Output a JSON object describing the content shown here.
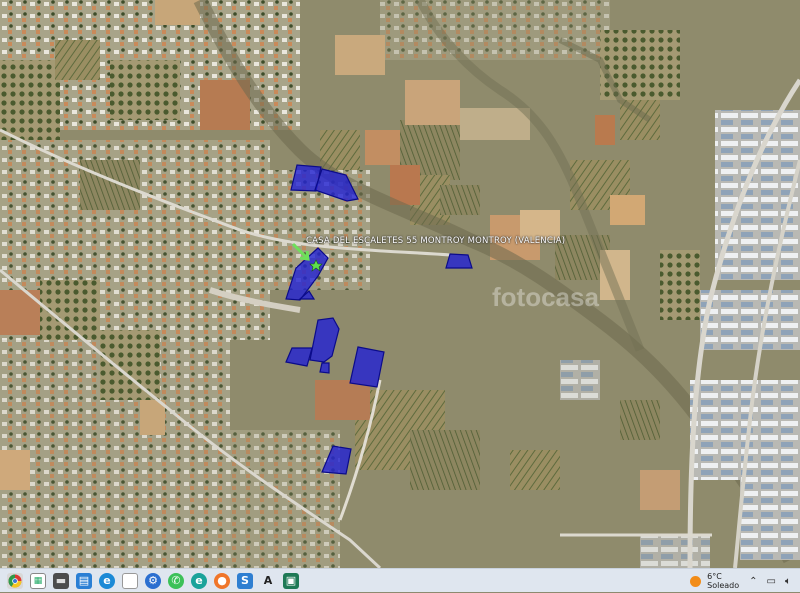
{
  "map": {
    "location_label": "CASA  DEL  ESCALETES  55  MONTROY MONTROY (VALENCIA)",
    "watermark": "fotocasa",
    "marker": "green-arrow-and-star"
  },
  "taskbar": {
    "items": [
      "chrome-icon",
      "vpn-icon",
      "folder-icon",
      "mail-icon",
      "edge-icon",
      "document-icon",
      "settings-icon",
      "whatsapp-icon",
      "edge-alt-icon",
      "firefox-icon",
      "app-s-icon",
      "app-a-icon",
      "screenshot-icon"
    ],
    "weather": {
      "temperature": "6°C",
      "condition": "Soleado"
    },
    "tray": [
      "chevron-up-icon",
      "network-icon",
      "volume-icon"
    ]
  },
  "colors": {
    "parcel": "#1f1fd6",
    "taskbar": "#dfe6ef",
    "sun": "#f28c18"
  }
}
